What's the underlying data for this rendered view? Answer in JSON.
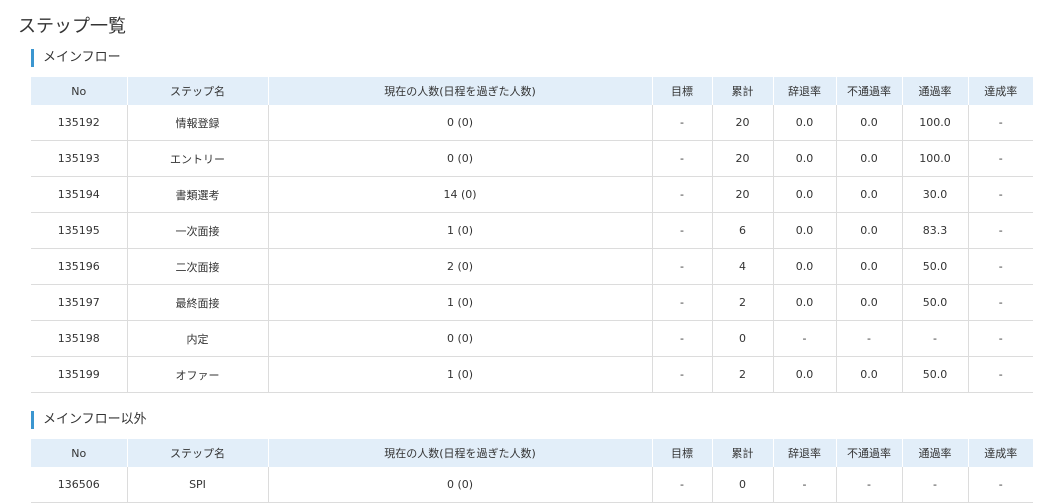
{
  "page": {
    "title": "ステップ一覧"
  },
  "columns": [
    "No",
    "ステップ名",
    "現在の人数(日程を過ぎた人数)",
    "目標",
    "累計",
    "辞退率",
    "不通過率",
    "通過率",
    "達成率"
  ],
  "main_flow": {
    "title": "メインフロー",
    "rows": [
      [
        "135192",
        "情報登録",
        "0 (0)",
        "-",
        "20",
        "0.0",
        "0.0",
        "100.0",
        "-"
      ],
      [
        "135193",
        "エントリー",
        "0 (0)",
        "-",
        "20",
        "0.0",
        "0.0",
        "100.0",
        "-"
      ],
      [
        "135194",
        "書類選考",
        "14 (0)",
        "-",
        "20",
        "0.0",
        "0.0",
        "30.0",
        "-"
      ],
      [
        "135195",
        "一次面接",
        "1 (0)",
        "-",
        "6",
        "0.0",
        "0.0",
        "83.3",
        "-"
      ],
      [
        "135196",
        "二次面接",
        "2 (0)",
        "-",
        "4",
        "0.0",
        "0.0",
        "50.0",
        "-"
      ],
      [
        "135197",
        "最終面接",
        "1 (0)",
        "-",
        "2",
        "0.0",
        "0.0",
        "50.0",
        "-"
      ],
      [
        "135198",
        "内定",
        "0 (0)",
        "-",
        "0",
        "-",
        "-",
        "-",
        "-"
      ],
      [
        "135199",
        "オファー",
        "1 (0)",
        "-",
        "2",
        "0.0",
        "0.0",
        "50.0",
        "-"
      ]
    ]
  },
  "other_flow": {
    "title": "メインフロー以外",
    "rows": [
      [
        "136506",
        "SPI",
        "0 (0)",
        "-",
        "0",
        "-",
        "-",
        "-",
        "-"
      ]
    ]
  },
  "colors": {
    "accent": "#3b96d0",
    "header_bg": "#e2eef9",
    "border": "#dcdcdc"
  }
}
